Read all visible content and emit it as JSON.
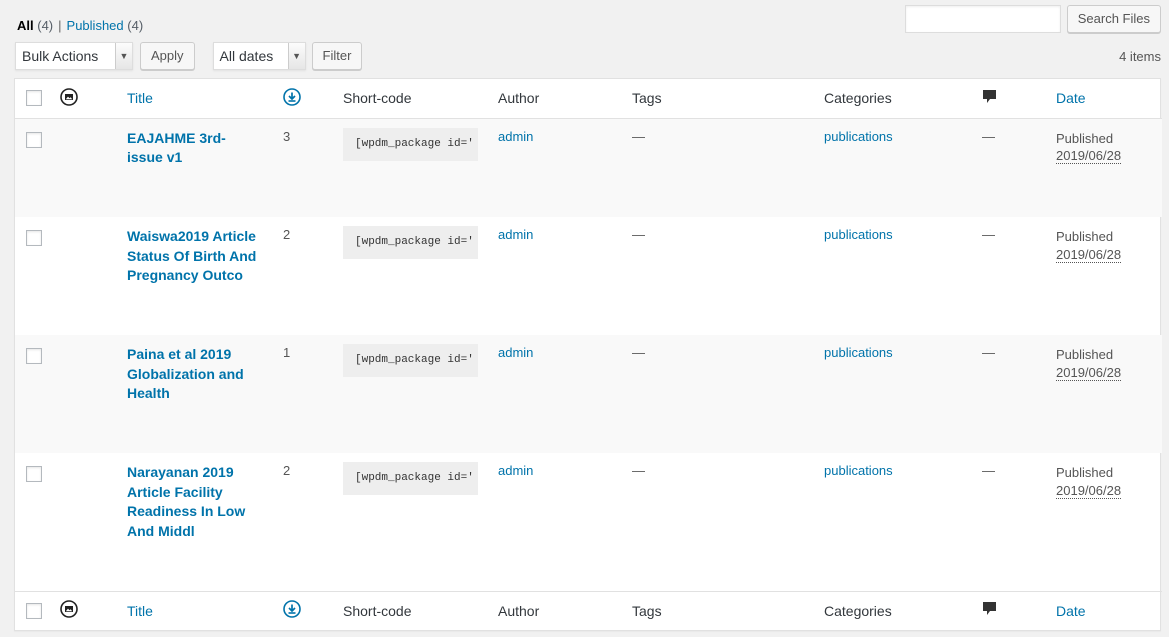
{
  "views": {
    "all_label": "All",
    "all_count": "(4)",
    "separator": "|",
    "published_label": "Published",
    "published_count": "(4)"
  },
  "search": {
    "value": "",
    "button_label": "Search Files"
  },
  "tablenav": {
    "bulk_actions": "Bulk Actions",
    "apply_label": "Apply",
    "dates_filter": "All dates",
    "filter_label": "Filter",
    "items_count": "4 items"
  },
  "columns": {
    "title": "Title",
    "shortcode": "Short-code",
    "author": "Author",
    "tags": "Tags",
    "categories": "Categories",
    "date": "Date"
  },
  "rows": [
    {
      "title": "EAJAHME 3rd-issue v1",
      "downloads": "3",
      "shortcode": "[wpdm_package id='",
      "author": "admin",
      "tags": "—",
      "category": "publications",
      "comments": "—",
      "status": "Published",
      "date": "2019/06/28"
    },
    {
      "title": "Waiswa2019 Article Status Of Birth And Pregnancy Outco",
      "downloads": "2",
      "shortcode": "[wpdm_package id='",
      "author": "admin",
      "tags": "—",
      "category": "publications",
      "comments": "—",
      "status": "Published",
      "date": "2019/06/28"
    },
    {
      "title": "Paina et al 2019 Globalization and Health",
      "downloads": "1",
      "shortcode": "[wpdm_package id='",
      "author": "admin",
      "tags": "—",
      "category": "publications",
      "comments": "—",
      "status": "Published",
      "date": "2019/06/28"
    },
    {
      "title": "Narayanan 2019 Article Facility Readiness In Low And Middl",
      "downloads": "2",
      "shortcode": "[wpdm_package id='",
      "author": "admin",
      "tags": "—",
      "category": "publications",
      "comments": "—",
      "status": "Published",
      "date": "2019/06/28"
    }
  ],
  "icons": {
    "image_column": "image-icon",
    "downloads_column": "download-icon",
    "comments_column": "comment-bubble-icon"
  },
  "colors": {
    "link": "#0073aa",
    "background": "#f1f1f1"
  }
}
